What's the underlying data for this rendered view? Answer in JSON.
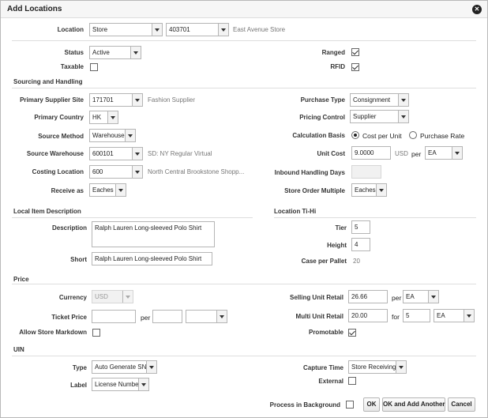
{
  "dialog": {
    "title": "Add Locations"
  },
  "location": {
    "label": "Location",
    "type": "Store",
    "id": "403701",
    "name": "East Avenue Store"
  },
  "status": {
    "label": "Status",
    "value": "Active"
  },
  "taxable": {
    "label": "Taxable",
    "checked": false
  },
  "ranged": {
    "label": "Ranged",
    "checked": true
  },
  "rfid": {
    "label": "RFID",
    "checked": true
  },
  "sourcing": {
    "heading": "Sourcing and Handling",
    "primary_supplier_site": {
      "label": "Primary Supplier Site",
      "value": "171701",
      "desc": "Fashion Supplier"
    },
    "primary_country": {
      "label": "Primary Country",
      "value": "HK"
    },
    "source_method": {
      "label": "Source Method",
      "value": "Warehouse"
    },
    "source_warehouse": {
      "label": "Source Warehouse",
      "value": "600101",
      "desc": "SD: NY Regular Virtual"
    },
    "costing_location": {
      "label": "Costing Location",
      "value": "600",
      "desc": "North Central Brookstone Shopp..."
    },
    "receive_as": {
      "label": "Receive as",
      "value": "Eaches"
    },
    "purchase_type": {
      "label": "Purchase Type",
      "value": "Consignment"
    },
    "pricing_control": {
      "label": "Pricing Control",
      "value": "Supplier"
    },
    "calculation_basis": {
      "label": "Calculation Basis",
      "option1": "Cost per Unit",
      "option2": "Purchase Rate",
      "selected": "Cost per Unit"
    },
    "unit_cost": {
      "label": "Unit Cost",
      "value": "9.0000",
      "currency": "USD",
      "per": "per",
      "uom": "EA"
    },
    "inbound_handling_days": {
      "label": "Inbound Handling Days",
      "value": ""
    },
    "store_order_multiple": {
      "label": "Store Order Multiple",
      "value": "Eaches"
    }
  },
  "local_item": {
    "heading": "Local Item Description",
    "description": {
      "label": "Description",
      "value": "Ralph Lauren Long-sleeved Polo Shirt"
    },
    "short": {
      "label": "Short",
      "value": "Ralph Lauren Long-sleeved Polo Shirt"
    }
  },
  "tihi": {
    "heading": "Location Ti-Hi",
    "tier": {
      "label": "Tier",
      "value": "5"
    },
    "height": {
      "label": "Height",
      "value": "4"
    },
    "case_per_pallet": {
      "label": "Case per Pallet",
      "value": "20"
    }
  },
  "price": {
    "heading": "Price",
    "currency": {
      "label": "Currency",
      "value": "USD"
    },
    "ticket_price": {
      "label": "Ticket Price",
      "value": "",
      "per": "per",
      "qty": "",
      "uom": ""
    },
    "allow_store_markdown": {
      "label": "Allow Store Markdown",
      "checked": false
    },
    "selling_unit_retail": {
      "label": "Selling Unit Retail",
      "value": "26.66",
      "per": "per",
      "uom": "EA"
    },
    "multi_unit_retail": {
      "label": "Multi Unit Retail",
      "value": "20.00",
      "for": "for",
      "qty": "5",
      "uom": "EA"
    },
    "promotable": {
      "label": "Promotable",
      "checked": true
    }
  },
  "uin": {
    "heading": "UIN",
    "type": {
      "label": "Type",
      "value": "Auto Generate SN"
    },
    "label_field": {
      "label": "Label",
      "value": "License Number"
    },
    "capture_time": {
      "label": "Capture Time",
      "value": "Store Receiving"
    },
    "external": {
      "label": "External",
      "checked": false
    }
  },
  "footer": {
    "process_in_background": {
      "label": "Process in Background",
      "checked": false
    },
    "ok": "OK",
    "ok_add_another": "OK and Add Another",
    "cancel": "Cancel"
  }
}
